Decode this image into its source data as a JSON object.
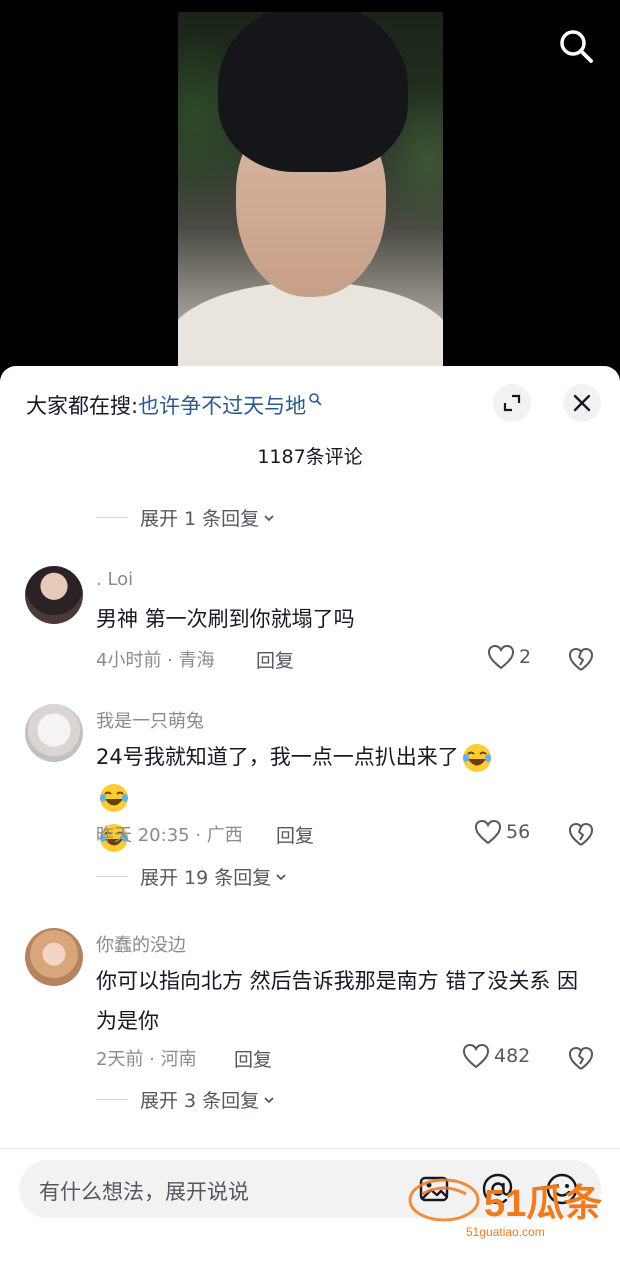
{
  "header": {
    "hot_search_prefix": "大家都在搜:",
    "hot_search_keyword": "也许争不过天与地"
  },
  "comment_count_label": "1187条评论",
  "replies_toggles": [
    {
      "label": "展开 1 条回复"
    },
    {
      "label": "展开 19 条回复"
    },
    {
      "label": "展开 3 条回复"
    }
  ],
  "comments": [
    {
      "user": ". Loi",
      "text": "男神 第一次刷到你就塌了吗",
      "meta": "4小时前 · 青海",
      "reply_label": "回复",
      "likes": "2"
    },
    {
      "user": "我是一只萌兔",
      "text": "24号我就知道了，我一点一点扒出来了",
      "meta": "昨天 20:35 · 广西",
      "reply_label": "回复",
      "likes": "56"
    },
    {
      "user": "你蠢的没边",
      "text": "你可以指向北方 然后告诉我那是南方 错了没关系 因为是你",
      "meta": "2天前 · 河南",
      "reply_label": "回复",
      "likes": "482"
    }
  ],
  "input": {
    "placeholder": "有什么想法，展开说说"
  },
  "watermark": {
    "brand": "51瓜条",
    "site": "51guatiao.com"
  },
  "colors": {
    "keyword": "#2d5a8c",
    "watermark": "#f07a1c",
    "sheet_bg": "#ffffff"
  }
}
